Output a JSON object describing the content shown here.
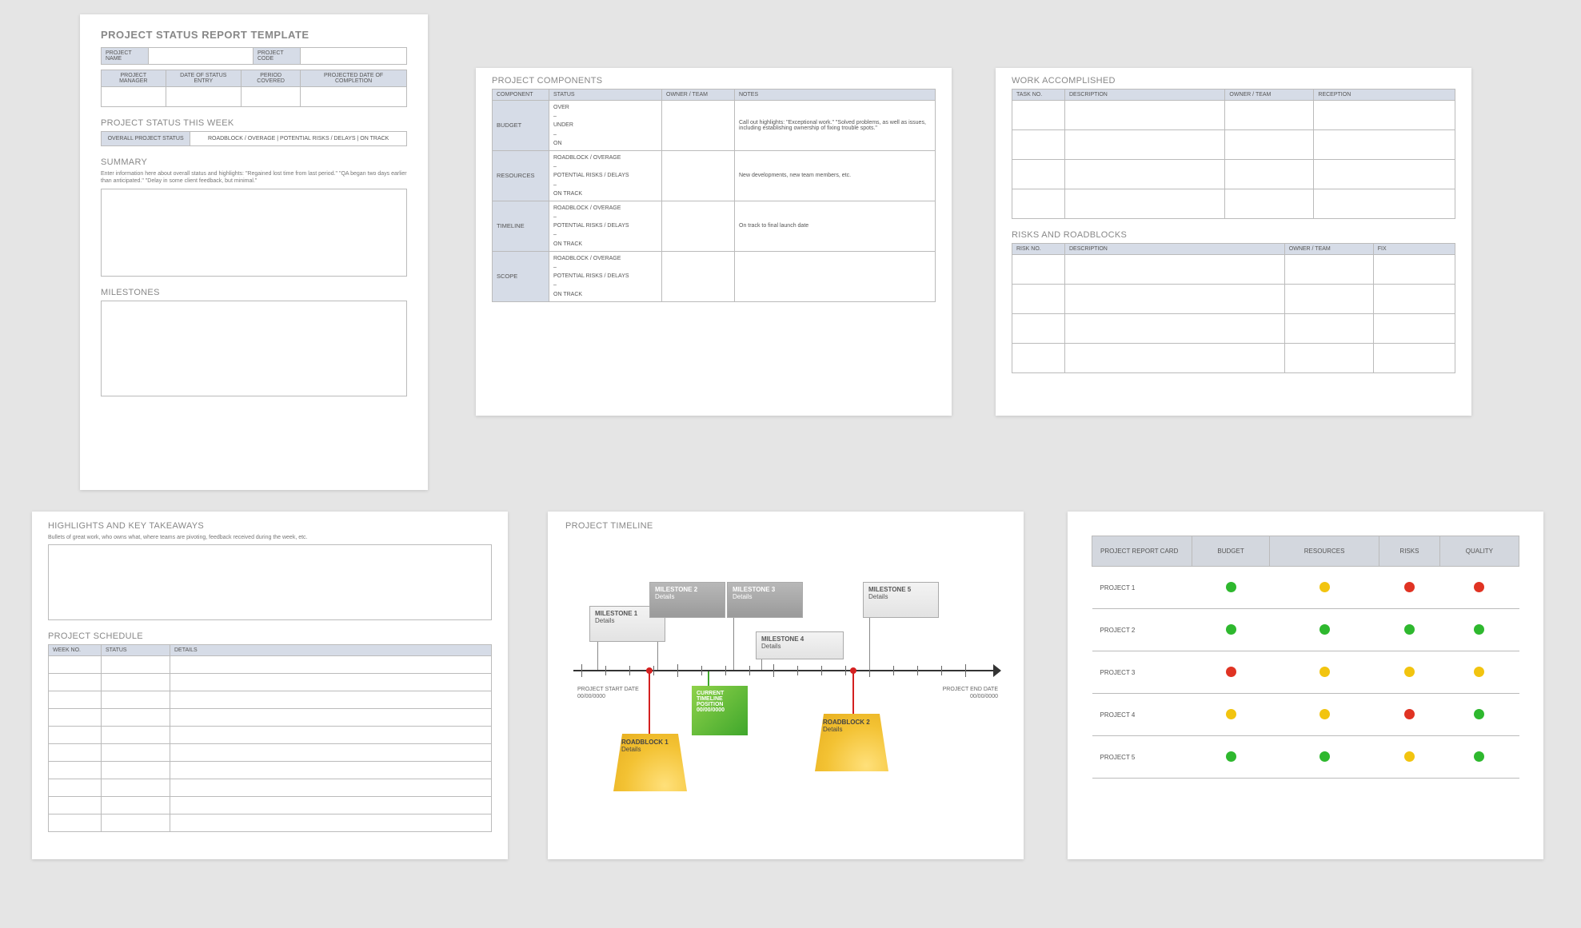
{
  "page1": {
    "title": "PROJECT STATUS REPORT TEMPLATE",
    "meta1": {
      "name_label": "PROJECT NAME",
      "code_label": "PROJECT CODE"
    },
    "meta2": [
      "PROJECT MANAGER",
      "DATE OF STATUS ENTRY",
      "PERIOD COVERED",
      "PROJECTED DATE OF COMPLETION"
    ],
    "status_heading": "PROJECT STATUS THIS WEEK",
    "status_row": [
      "OVERALL PROJECT STATUS",
      "ROADBLOCK / OVERAGE   |   POTENTIAL RISKS / DELAYS   |   ON TRACK"
    ],
    "summary_heading": "SUMMARY",
    "summary_hint": "Enter information here about overall status and highlights: \"Regained lost time from last period.\" \"QA began two days earlier than anticipated.\" \"Delay in some client feedback, but minimal.\"",
    "milestones_heading": "MILESTONES"
  },
  "page2": {
    "heading": "PROJECT COMPONENTS",
    "cols": [
      "COMPONENT",
      "STATUS",
      "OWNER / TEAM",
      "NOTES"
    ],
    "rows": [
      {
        "name": "BUDGET",
        "status": "OVER\n–\nUNDER\n–\nON",
        "notes": "Call out highlights: \"Exceptional work.\" \"Solved problems, as well as issues, including establishing ownership of fixing trouble spots.\""
      },
      {
        "name": "RESOURCES",
        "status": "ROADBLOCK / OVERAGE\n–\nPOTENTIAL RISKS / DELAYS\n–\nON TRACK",
        "notes": "New developments, new team members, etc."
      },
      {
        "name": "TIMELINE",
        "status": "ROADBLOCK / OVERAGE\n–\nPOTENTIAL RISKS / DELAYS\n–\nON TRACK",
        "notes": "On track to final launch date"
      },
      {
        "name": "SCOPE",
        "status": "ROADBLOCK / OVERAGE\n–\nPOTENTIAL RISKS / DELAYS\n–\nON TRACK",
        "notes": ""
      }
    ]
  },
  "page3": {
    "work_heading": "WORK ACCOMPLISHED",
    "work_cols": [
      "TASK NO.",
      "DESCRIPTION",
      "OWNER / TEAM",
      "RECEPTION"
    ],
    "risk_heading": "RISKS AND ROADBLOCKS",
    "risk_cols": [
      "RISK NO.",
      "DESCRIPTION",
      "OWNER / TEAM",
      "FIX"
    ]
  },
  "page4": {
    "high_heading": "HIGHLIGHTS AND KEY TAKEAWAYS",
    "high_hint": "Bullets of great work, who owns what, where teams are pivoting, feedback received during the week, etc.",
    "sched_heading": "PROJECT SCHEDULE",
    "sched_cols": [
      "WEEK NO.",
      "STATUS",
      "DETAILS"
    ]
  },
  "page5": {
    "heading": "PROJECT TIMELINE",
    "start_label": "PROJECT START DATE",
    "start_date": "00/00/0000",
    "end_label": "PROJECT END DATE",
    "end_date": "00/00/0000",
    "milestones": [
      {
        "t": "MILESTONE 1",
        "d": "Details"
      },
      {
        "t": "MILESTONE 2",
        "d": "Details"
      },
      {
        "t": "MILESTONE 3",
        "d": "Details"
      },
      {
        "t": "MILESTONE 4",
        "d": "Details"
      },
      {
        "t": "MILESTONE 5",
        "d": "Details"
      }
    ],
    "current": {
      "l1": "CURRENT",
      "l2": "TIMELINE",
      "l3": "POSITION",
      "date": "00/00/0000"
    },
    "roadblocks": [
      {
        "t": "ROADBLOCK 1",
        "d": "Details"
      },
      {
        "t": "ROADBLOCK 2",
        "d": "Details"
      }
    ]
  },
  "page6": {
    "head": [
      "PROJECT REPORT CARD",
      "BUDGET",
      "RESOURCES",
      "RISKS",
      "QUALITY"
    ],
    "rows": [
      {
        "name": "PROJECT 1",
        "c": [
          "g",
          "y",
          "r",
          "r"
        ]
      },
      {
        "name": "PROJECT 2",
        "c": [
          "g",
          "g",
          "g",
          "g"
        ]
      },
      {
        "name": "PROJECT 3",
        "c": [
          "r",
          "y",
          "y",
          "y"
        ]
      },
      {
        "name": "PROJECT 4",
        "c": [
          "y",
          "y",
          "r",
          "g"
        ]
      },
      {
        "name": "PROJECT 5",
        "c": [
          "g",
          "g",
          "y",
          "g"
        ]
      }
    ]
  }
}
